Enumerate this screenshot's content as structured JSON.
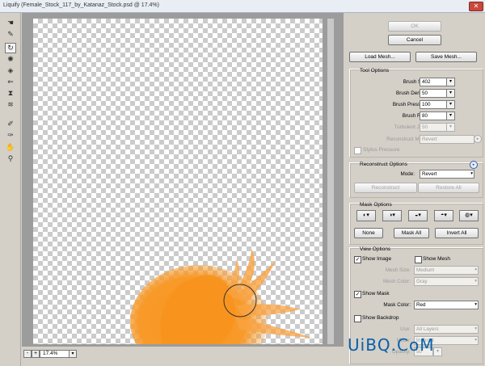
{
  "window": {
    "title": "Liquify (Female_Stock_117_by_Katanaz_Stock.psd @ 17.4%)"
  },
  "tools": [
    {
      "icon": "forward-warp-icon",
      "glyph": "🖐"
    },
    {
      "icon": "reconstruct-icon",
      "glyph": "✎"
    },
    {
      "icon": "twirl-icon",
      "glyph": "↻",
      "selected": true
    },
    {
      "icon": "pucker-icon",
      "glyph": "✺"
    },
    {
      "icon": "bloat-icon",
      "glyph": "◈"
    },
    {
      "icon": "push-left-icon",
      "glyph": "⇐"
    },
    {
      "icon": "mirror-icon",
      "glyph": "⧗"
    },
    {
      "icon": "turbulence-icon",
      "glyph": "≋"
    },
    {
      "icon": "freeze-mask-icon",
      "glyph": "✐"
    },
    {
      "icon": "thaw-mask-icon",
      "glyph": "✑"
    },
    {
      "icon": "hand-icon",
      "glyph": "✋"
    },
    {
      "icon": "zoom-icon",
      "glyph": "⚲"
    }
  ],
  "status": {
    "zoom": "17.4%",
    "minus": "-",
    "plus": "+"
  },
  "buttons": {
    "ok": "OK",
    "cancel": "Cancel",
    "load_mesh": "Load Mesh...",
    "save_mesh": "Save Mesh..."
  },
  "tool_options": {
    "title": "Tool Options",
    "brush_size_label": "Brush Size:",
    "brush_size": "402",
    "brush_density_label": "Brush Density:",
    "brush_density": "50",
    "brush_pressure_label": "Brush Pressure:",
    "brush_pressure": "100",
    "brush_rate_label": "Brush Rate:",
    "brush_rate": "80",
    "turbulent_jitter_label": "Turbulent Jitter:",
    "turbulent_jitter": "50",
    "reconstruct_mode_label": "Reconstruct Mode:",
    "reconstruct_mode": "Revert",
    "stylus_pressure": "Stylus Pressure"
  },
  "reconstruct_options": {
    "title": "Reconstruct Options",
    "mode_label": "Mode:",
    "mode": "Revert",
    "reconstruct": "Reconstruct",
    "restore_all": "Restore All"
  },
  "mask_options": {
    "title": "Mask Options",
    "none": "None",
    "mask_all": "Mask All",
    "invert_all": "Invert All"
  },
  "view_options": {
    "title": "View Options",
    "show_image": "Show Image",
    "show_mesh": "Show Mesh",
    "mesh_size_label": "Mesh Size:",
    "mesh_size": "Medium",
    "mesh_color_label": "Mesh Color:",
    "mesh_color": "Gray",
    "show_mask": "Show Mask",
    "mask_color_label": "Mask Color:",
    "mask_color": "Red",
    "show_backdrop": "Show Backdrop",
    "use_label": "Use:",
    "use": "All Layers",
    "mode_label": "Mode:",
    "mode": "In Front",
    "opacity_label": "Opacity:",
    "opacity": "50"
  },
  "watermark": "UiBQ.CoM",
  "colors": {
    "paint": "#f7941d",
    "accent": "#0a5fa8"
  }
}
